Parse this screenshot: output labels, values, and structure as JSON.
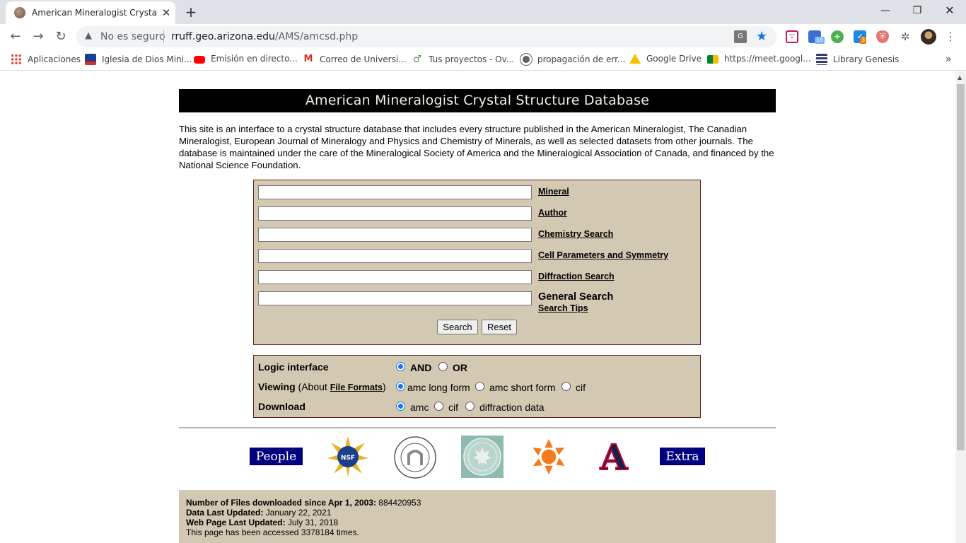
{
  "browser": {
    "tab_title": "American Mineralogist Crystal St",
    "security_label": "No es seguro",
    "url_host": "rruff.geo.arizona.edu",
    "url_path": "/AMS/amcsd.php",
    "ext_badges": {
      "calendar": "1h",
      "tasks": "3"
    }
  },
  "bookmarks": [
    {
      "label": "Aplicaciones",
      "icon": "apps-grid-icon",
      "color": "#4285f4"
    },
    {
      "label": "Iglesia de Dios Mini...",
      "icon": "church-icon",
      "color": "#1d3f8f"
    },
    {
      "label": "Emisión en directo...",
      "icon": "youtube-icon",
      "color": "#ff0000"
    },
    {
      "label": "Correo de Universi...",
      "icon": "gmail-icon",
      "color": "#d93025"
    },
    {
      "label": "Tus proyectos - Ov...",
      "icon": "overleaf-icon",
      "color": "#4f9c45"
    },
    {
      "label": "propagación de err...",
      "icon": "globe-icon",
      "color": "#5f6368"
    },
    {
      "label": "Google Drive",
      "icon": "drive-icon",
      "color": "#fbbc04"
    },
    {
      "label": "https://meet.googl...",
      "icon": "meet-icon",
      "color": "#00832d"
    },
    {
      "label": "Library Genesis",
      "icon": "libgen-icon",
      "color": "#333a6b"
    }
  ],
  "page": {
    "banner": "American Mineralogist Crystal Structure Database",
    "intro": "This site is an interface to a crystal structure database that includes every structure published in the American Mineralogist, The Canadian Mineralogist, European Journal of Mineralogy and Physics and Chemistry of Minerals, as well as selected datasets from other journals. The database is maintained under the care of the Mineralogical Society of America and the Mineralogical Association of Canada, and financed by the National Science Foundation.",
    "search_fields": [
      {
        "label": "Mineral",
        "value": ""
      },
      {
        "label": "Author",
        "value": ""
      },
      {
        "label": "Chemistry Search",
        "value": ""
      },
      {
        "label": "Cell Parameters and Symmetry",
        "value": ""
      },
      {
        "label": "Diffraction Search",
        "value": ""
      }
    ],
    "general_search": {
      "label": "General Search",
      "tips": "Search Tips",
      "value": ""
    },
    "buttons": {
      "search": "Search",
      "reset": "Reset"
    },
    "options": {
      "logic": {
        "label": "Logic interface",
        "choices": [
          "AND",
          "OR"
        ],
        "selected": "AND"
      },
      "viewing": {
        "label": "Viewing",
        "about_prefix": "(About ",
        "about_link": "File Formats",
        "about_suffix": ")",
        "choices": [
          "amc long form",
          "amc short form",
          "cif"
        ],
        "selected": "amc long form"
      },
      "download": {
        "label": "Download",
        "choices": [
          "amc",
          "cif",
          "diffraction data"
        ],
        "selected": "amc"
      }
    },
    "logos": {
      "people": "People",
      "nsf": "NSF",
      "extra": "Extra",
      "arizona": "A"
    },
    "footer": {
      "downloads_label": "Number of Files downloaded since Apr 1, 2003:",
      "downloads_value": "884420953",
      "data_updated_label": "Data Last Updated:",
      "data_updated_value": "January 22, 2021",
      "page_updated_label": "Web Page Last Updated:",
      "page_updated_value": "July 31, 2018",
      "access_text": "This page has been accessed 3378184 times."
    }
  },
  "colors": {
    "panel_bg": "#d3c8b2",
    "panel_border": "#5a2222",
    "banner_bg": "#000000",
    "logo_blue": "#000080",
    "radio_accent": "#1a73e8"
  }
}
